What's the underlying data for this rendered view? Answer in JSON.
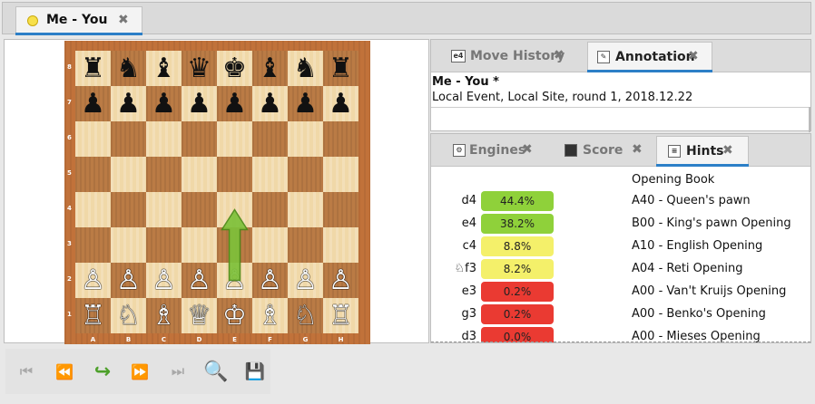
{
  "window": {
    "game_tab_title": "Me  -  You",
    "game_tab_close": "✖"
  },
  "board": {
    "ranks": [
      "8",
      "7",
      "6",
      "5",
      "4",
      "3",
      "2",
      "1"
    ],
    "files": [
      "A",
      "B",
      "C",
      "D",
      "E",
      "F",
      "G",
      "H"
    ],
    "rows": [
      [
        "♜",
        "♞",
        "♝",
        "♛",
        "♚",
        "♝",
        "♞",
        "♜"
      ],
      [
        "♟",
        "♟",
        "♟",
        "♟",
        "♟",
        "♟",
        "♟",
        "♟"
      ],
      [
        "",
        "",
        "",
        "",
        "",
        "",
        "",
        ""
      ],
      [
        "",
        "",
        "",
        "",
        "",
        "",
        "",
        ""
      ],
      [
        "",
        "",
        "",
        "",
        "",
        "",
        "",
        ""
      ],
      [
        "",
        "",
        "",
        "",
        "",
        "",
        "",
        ""
      ],
      [
        "♙",
        "♙",
        "♙",
        "♙",
        "♙",
        "♙",
        "♙",
        "♙"
      ],
      [
        "♖",
        "♘",
        "♗",
        "♕",
        "♔",
        "♗",
        "♘",
        "♖"
      ]
    ],
    "arrow": {
      "from": "e2",
      "to": "e4",
      "color": "#7ec13a"
    }
  },
  "top_panel": {
    "tabs": [
      {
        "icon": "e4",
        "label": "Move History",
        "close": "✖",
        "active": false
      },
      {
        "icon": "✎",
        "label": "Annotation",
        "close": "✖",
        "active": true
      }
    ],
    "annotation_title": "Me - You *",
    "annotation_subtitle": "Local Event, Local Site, round 1, 2018.12.22"
  },
  "bottom_panel": {
    "tabs": [
      {
        "label": "Engines",
        "close": "✖",
        "active": false
      },
      {
        "label": "Score",
        "close": "✖",
        "active": false
      },
      {
        "label": "Hints",
        "close": "✖",
        "active": true
      }
    ],
    "book_header": "Opening Book",
    "hints": [
      {
        "move": "d4",
        "pct": "44.4%",
        "color": "#8fd13a",
        "opening": "A40 - Queen's pawn"
      },
      {
        "move": "e4",
        "pct": "38.2%",
        "color": "#8fd13a",
        "opening": "B00 - King's pawn Opening"
      },
      {
        "move": "c4",
        "pct": "8.8%",
        "color": "#f4f06a",
        "opening": "A10 - English Opening"
      },
      {
        "move": "♘f3",
        "pct": "8.2%",
        "color": "#f4f06a",
        "opening": "A04 - Reti Opening"
      },
      {
        "move": "e3",
        "pct": "0.2%",
        "color": "#ea3a32",
        "opening": "A00 - Van't Kruijs Opening"
      },
      {
        "move": "g3",
        "pct": "0.2%",
        "color": "#ea3a32",
        "opening": "A00 - Benko's Opening"
      },
      {
        "move": "d3",
        "pct": "0.0%",
        "color": "#ea3a32",
        "opening": "A00 - Mieses Opening"
      }
    ]
  },
  "toolbar": {
    "first": "⏮",
    "prev": "⏪",
    "play": "↪",
    "next": "⏩",
    "last": "⏭",
    "search": "🔍",
    "save": "💾"
  }
}
